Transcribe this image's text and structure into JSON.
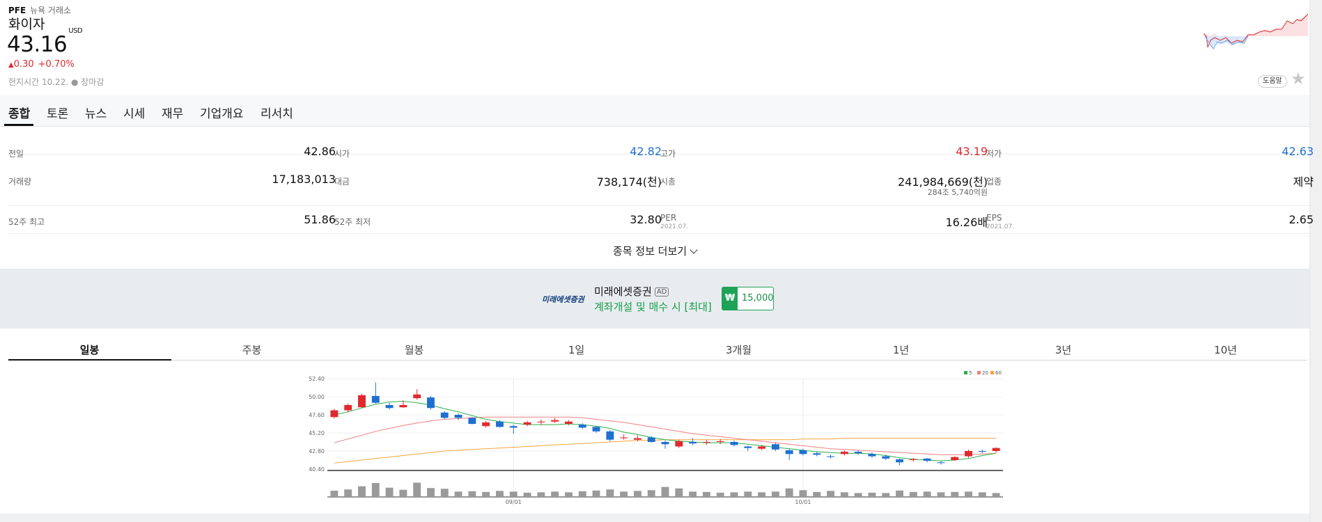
{
  "header": {
    "ticker": "PFE",
    "exchange": "뉴욕 거래소",
    "name": "화이자",
    "price": "43.16",
    "currency": "USD",
    "change": "0.30",
    "change_pct": "+0.70%",
    "change_arrow": "▲",
    "local_time": "현지시간 10.22. ● 장마감",
    "help_label": "도움말",
    "favorite_icon": "star-icon"
  },
  "tabs": [
    {
      "label": "종합"
    },
    {
      "label": "토론"
    },
    {
      "label": "뉴스"
    },
    {
      "label": "시세"
    },
    {
      "label": "재무"
    },
    {
      "label": "기업개요"
    },
    {
      "label": "리서치"
    }
  ],
  "stats": {
    "prev_close": {
      "label": "전일",
      "value": "42.86"
    },
    "open": {
      "label": "시가",
      "value": "42.82"
    },
    "high": {
      "label": "고가",
      "value": "43.19"
    },
    "low": {
      "label": "저가",
      "value": "42.63"
    },
    "volume": {
      "label": "거래량",
      "value": "17,183,013"
    },
    "amount": {
      "label": "대금",
      "value": "738,174(천)"
    },
    "market_cap": {
      "label": "시총",
      "value": "241,984,669(천)",
      "sub_value": "284조 5,740억원"
    },
    "industry": {
      "label": "업종",
      "value": "제약"
    },
    "w52_high": {
      "label": "52주 최고",
      "value": "51.86"
    },
    "w52_low": {
      "label": "52주 최저",
      "value": "32.80"
    },
    "per": {
      "label": "PER",
      "date": "2021.07.",
      "value": "16.26배"
    },
    "eps": {
      "label": "EPS",
      "date": "2021.07.",
      "value": "2.65"
    },
    "more_label": "종목 정보 더보기"
  },
  "ad": {
    "logo": "미래에셋증권",
    "title": "미래에셋증권",
    "tag": "AD",
    "description": "계좌개설 및 매수 시 [최대]",
    "badge_symbol": "₩",
    "badge_amount": "15,000"
  },
  "period_tabs": [
    {
      "label": "일봉"
    },
    {
      "label": "주봉"
    },
    {
      "label": "월봉"
    },
    {
      "label": "1일"
    },
    {
      "label": "3개월"
    },
    {
      "label": "1년"
    },
    {
      "label": "3년"
    },
    {
      "label": "10년"
    }
  ],
  "colors": {
    "up": "#e0292e",
    "down": "#1f6fd1",
    "ma5": "#2ab04a",
    "ma20": "#f08080",
    "ma60": "#f5a540"
  },
  "chart_data": {
    "type": "candlestick",
    "y_ticks": [
      "52.40",
      "50.00",
      "47.60",
      "45.20",
      "42.80",
      "40.40"
    ],
    "ylim": [
      40.4,
      52.4
    ],
    "x_ticks": [
      {
        "label": "09/01",
        "index": 13
      },
      {
        "label": "10/01",
        "index": 34
      }
    ],
    "legend": [
      {
        "name": "5"
      },
      {
        "name": "20"
      },
      {
        "name": "60"
      }
    ],
    "legend_position": "top-right",
    "candles": [
      {
        "o": 47.3,
        "c": 48.2,
        "h": 48.4,
        "l": 47.1,
        "v": 0.35
      },
      {
        "o": 48.2,
        "c": 48.9,
        "h": 49.1,
        "l": 47.9,
        "v": 0.42
      },
      {
        "o": 48.6,
        "c": 50.2,
        "h": 50.4,
        "l": 48.5,
        "v": 0.6
      },
      {
        "o": 50.1,
        "c": 49.2,
        "h": 51.9,
        "l": 49.1,
        "v": 0.78
      },
      {
        "o": 48.9,
        "c": 48.5,
        "h": 49.2,
        "l": 48.3,
        "v": 0.52
      },
      {
        "o": 48.6,
        "c": 48.9,
        "h": 49.5,
        "l": 48.5,
        "v": 0.4
      },
      {
        "o": 49.8,
        "c": 50.3,
        "h": 51.0,
        "l": 49.6,
        "v": 0.8
      },
      {
        "o": 49.9,
        "c": 48.5,
        "h": 50.1,
        "l": 48.3,
        "v": 0.5
      },
      {
        "o": 47.9,
        "c": 47.2,
        "h": 48.1,
        "l": 47.0,
        "v": 0.46
      },
      {
        "o": 47.6,
        "c": 47.2,
        "h": 47.8,
        "l": 46.9,
        "v": 0.3
      },
      {
        "o": 47.2,
        "c": 46.4,
        "h": 47.3,
        "l": 46.3,
        "v": 0.32
      },
      {
        "o": 46.1,
        "c": 46.6,
        "h": 46.8,
        "l": 45.9,
        "v": 0.28
      },
      {
        "o": 46.7,
        "c": 46.0,
        "h": 46.9,
        "l": 45.9,
        "v": 0.34
      },
      {
        "o": 46.1,
        "c": 45.9,
        "h": 46.3,
        "l": 45.1,
        "v": 0.3
      },
      {
        "o": 46.3,
        "c": 46.6,
        "h": 46.8,
        "l": 46.1,
        "v": 0.24
      },
      {
        "o": 46.6,
        "c": 46.7,
        "h": 47.0,
        "l": 46.3,
        "v": 0.26
      },
      {
        "o": 46.7,
        "c": 46.9,
        "h": 47.2,
        "l": 46.5,
        "v": 0.3
      },
      {
        "o": 46.4,
        "c": 46.7,
        "h": 46.9,
        "l": 46.2,
        "v": 0.26
      },
      {
        "o": 46.3,
        "c": 45.9,
        "h": 46.5,
        "l": 45.7,
        "v": 0.32
      },
      {
        "o": 46.0,
        "c": 45.4,
        "h": 46.1,
        "l": 45.2,
        "v": 0.36
      },
      {
        "o": 45.4,
        "c": 44.3,
        "h": 45.6,
        "l": 44.1,
        "v": 0.42
      },
      {
        "o": 44.5,
        "c": 44.6,
        "h": 45.0,
        "l": 44.3,
        "v": 0.3
      },
      {
        "o": 44.3,
        "c": 44.5,
        "h": 44.9,
        "l": 44.1,
        "v": 0.34
      },
      {
        "o": 44.6,
        "c": 44.0,
        "h": 44.8,
        "l": 43.9,
        "v": 0.38
      },
      {
        "o": 44.0,
        "c": 43.7,
        "h": 44.2,
        "l": 43.1,
        "v": 0.56
      },
      {
        "o": 43.4,
        "c": 44.1,
        "h": 44.3,
        "l": 43.2,
        "v": 0.48
      },
      {
        "o": 44.0,
        "c": 43.8,
        "h": 44.5,
        "l": 43.6,
        "v": 0.3
      },
      {
        "o": 43.9,
        "c": 44.0,
        "h": 44.3,
        "l": 43.6,
        "v": 0.28
      },
      {
        "o": 44.0,
        "c": 44.1,
        "h": 44.4,
        "l": 43.7,
        "v": 0.24
      },
      {
        "o": 44.0,
        "c": 43.6,
        "h": 44.2,
        "l": 43.4,
        "v": 0.26
      },
      {
        "o": 43.4,
        "c": 43.2,
        "h": 43.5,
        "l": 42.8,
        "v": 0.3
      },
      {
        "o": 43.1,
        "c": 43.4,
        "h": 43.6,
        "l": 42.9,
        "v": 0.26
      },
      {
        "o": 43.7,
        "c": 43.0,
        "h": 43.9,
        "l": 42.8,
        "v": 0.3
      },
      {
        "o": 42.9,
        "c": 42.4,
        "h": 43.1,
        "l": 41.6,
        "v": 0.48
      },
      {
        "o": 42.9,
        "c": 42.4,
        "h": 43.1,
        "l": 42.2,
        "v": 0.38
      },
      {
        "o": 42.5,
        "c": 42.3,
        "h": 42.7,
        "l": 42.1,
        "v": 0.28
      },
      {
        "o": 42.1,
        "c": 42.0,
        "h": 42.3,
        "l": 41.8,
        "v": 0.34
      },
      {
        "o": 42.4,
        "c": 42.7,
        "h": 42.9,
        "l": 42.2,
        "v": 0.26
      },
      {
        "o": 42.7,
        "c": 42.5,
        "h": 42.9,
        "l": 42.3,
        "v": 0.22
      },
      {
        "o": 42.4,
        "c": 42.1,
        "h": 42.6,
        "l": 41.9,
        "v": 0.24
      },
      {
        "o": 42.1,
        "c": 41.8,
        "h": 42.3,
        "l": 41.6,
        "v": 0.22
      },
      {
        "o": 41.7,
        "c": 41.3,
        "h": 41.8,
        "l": 40.9,
        "v": 0.36
      },
      {
        "o": 41.6,
        "c": 41.7,
        "h": 41.9,
        "l": 41.4,
        "v": 0.28
      },
      {
        "o": 41.8,
        "c": 41.5,
        "h": 41.9,
        "l": 41.3,
        "v": 0.3
      },
      {
        "o": 41.3,
        "c": 41.2,
        "h": 41.5,
        "l": 41.0,
        "v": 0.26
      },
      {
        "o": 41.6,
        "c": 42.0,
        "h": 42.1,
        "l": 41.5,
        "v": 0.28
      },
      {
        "o": 42.1,
        "c": 42.8,
        "h": 43.0,
        "l": 41.9,
        "v": 0.3
      },
      {
        "o": 42.8,
        "c": 42.7,
        "h": 43.0,
        "l": 42.5,
        "v": 0.26
      },
      {
        "o": 42.8,
        "c": 43.2,
        "h": 43.3,
        "l": 42.6,
        "v": 0.22
      }
    ],
    "ma5": [
      47.6,
      48.0,
      48.5,
      49.0,
      49.3,
      49.4,
      49.2,
      48.9,
      48.4,
      48.0,
      47.5,
      47.0,
      46.7,
      46.5,
      46.3,
      46.3,
      46.3,
      46.4,
      46.3,
      46.1,
      45.8,
      45.3,
      45.0,
      44.6,
      44.3,
      44.1,
      44.0,
      43.9,
      43.9,
      43.9,
      43.7,
      43.5,
      43.3,
      43.1,
      42.9,
      42.7,
      42.6,
      42.5,
      42.5,
      42.4,
      42.2,
      41.9,
      41.7,
      41.6,
      41.5,
      41.6,
      41.8,
      42.2,
      42.5
    ],
    "ma20": [
      43.9,
      44.4,
      44.9,
      45.4,
      45.8,
      46.2,
      46.5,
      46.8,
      47.0,
      47.1,
      47.2,
      47.3,
      47.3,
      47.3,
      47.3,
      47.3,
      47.3,
      47.3,
      47.2,
      47.0,
      46.8,
      46.6,
      46.3,
      46.0,
      45.7,
      45.4,
      45.1,
      44.9,
      44.7,
      44.5,
      44.3,
      44.1,
      43.9,
      43.7,
      43.5,
      43.3,
      43.1,
      43.0,
      42.9,
      42.8,
      42.7,
      42.6,
      42.5,
      42.4,
      42.3,
      42.3,
      42.3,
      42.4,
      42.5
    ],
    "ma60": [
      41.2,
      41.4,
      41.6,
      41.8,
      42.0,
      42.2,
      42.4,
      42.6,
      42.8,
      42.9,
      43.0,
      43.1,
      43.2,
      43.3,
      43.4,
      43.5,
      43.6,
      43.7,
      43.8,
      43.9,
      44.0,
      44.1,
      44.2,
      44.2,
      44.3,
      44.3,
      44.3,
      44.3,
      44.3,
      44.3,
      44.3,
      44.3,
      44.3,
      44.3,
      44.4,
      44.4,
      44.4,
      44.5,
      44.5,
      44.5,
      44.5,
      44.5,
      44.5,
      44.5,
      44.5,
      44.5,
      44.5,
      44.5,
      44.5
    ]
  }
}
